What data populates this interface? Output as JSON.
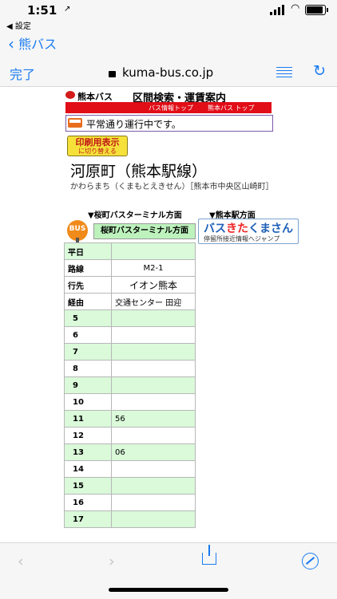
{
  "status": {
    "time": "1:51",
    "location_arrow": "↗",
    "back_app": "◀ 設定"
  },
  "nav": {
    "back_label": "熊バス"
  },
  "browser": {
    "done_label": "完了",
    "url": "kuma-bus.co.jp"
  },
  "header": {
    "logo_text": "熊本バス",
    "title": "区間検索・運賃案内",
    "links": [
      "バス情報トップ",
      "熊本バス トップ"
    ]
  },
  "notice": "平常通り運行中です。",
  "print_button": {
    "line1": "印刷用表示",
    "line2": "に切り替える"
  },
  "stop": {
    "name": "河原町（熊本駅線）",
    "reading": "かわらまち（くまもとえきせん）［熊本市中央区山崎町］"
  },
  "directions": {
    "left_label": "▼桜町バスターミナル方面",
    "right_label": "▼熊本駅方面",
    "bus_badge": "BUS",
    "left_button": "桜町バスターミナル方面",
    "app_banner": {
      "part1": "バス",
      "part2": "きた",
      "part3": "くまさん",
      "tagline": "停留所接近情報へジャンプ"
    }
  },
  "timetable": {
    "day_type": "平日",
    "route_label": "路線",
    "route_value": "M2-1",
    "dest_label": "行先",
    "dest_value": "イオン熊本",
    "via_label": "経由",
    "via_value": "交通センター 田迎",
    "hours": [
      {
        "h": "5",
        "m": ""
      },
      {
        "h": "6",
        "m": ""
      },
      {
        "h": "7",
        "m": ""
      },
      {
        "h": "8",
        "m": ""
      },
      {
        "h": "9",
        "m": ""
      },
      {
        "h": "10",
        "m": ""
      },
      {
        "h": "11",
        "m": "56"
      },
      {
        "h": "12",
        "m": ""
      },
      {
        "h": "13",
        "m": "06"
      },
      {
        "h": "14",
        "m": ""
      },
      {
        "h": "15",
        "m": ""
      },
      {
        "h": "16",
        "m": ""
      },
      {
        "h": "17",
        "m": ""
      }
    ]
  },
  "toolbar": {
    "back_icon": "‹",
    "forward_icon": "›"
  }
}
